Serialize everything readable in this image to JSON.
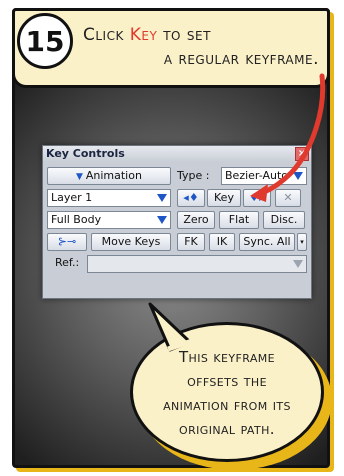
{
  "step": "15",
  "caption": {
    "line1_prefix": "Click ",
    "line1_highlight": "Key",
    "line1_suffix": " to set",
    "line2": "a regular keyframe."
  },
  "panel": {
    "title": "Key Controls",
    "close_glyph": "×",
    "row1": {
      "animation_label": "Animation",
      "type_label": "Type :",
      "type_value": "Bezier-Auto"
    },
    "row2": {
      "layer_value": "Layer 1",
      "prev_key_glyph": "◂♦",
      "key_label": "Key",
      "next_key_glyph": "♦▸",
      "delete_glyph": "✕"
    },
    "row3": {
      "body_value": "Full Body",
      "zero_label": "Zero",
      "flat_label": "Flat",
      "disc_label": "Disc."
    },
    "row4": {
      "key_icon_glyph": "⊱⊸",
      "move_keys_label": "Move Keys",
      "fk_label": "FK",
      "ik_label": "IK",
      "sync_label": "Sync. All"
    },
    "row5": {
      "ref_label": "Ref.:",
      "ref_value": ""
    }
  },
  "bubble": {
    "lines": [
      "This keyframe",
      "offsets the",
      "animation from its",
      "original path."
    ]
  },
  "colors": {
    "highlight": "#e0392d",
    "arrow": "#e0392d",
    "caption_bg": "#fbf1c9",
    "shadow": "#e8b619"
  }
}
